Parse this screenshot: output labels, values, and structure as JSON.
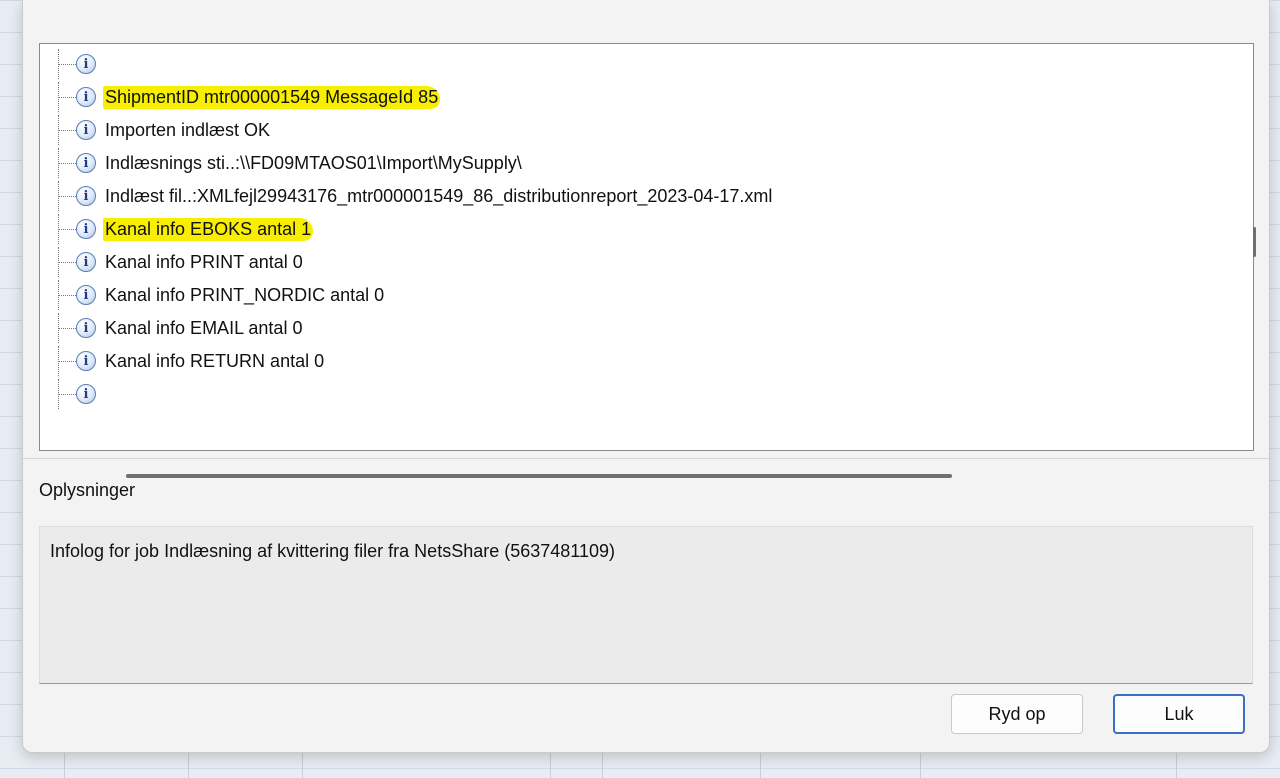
{
  "log_tree": {
    "items": [
      {
        "text": "",
        "highlighted": false
      },
      {
        "text": "ShipmentID mtr000001549 MessageId 85",
        "highlighted": true
      },
      {
        "text": "Importen indlæst OK",
        "highlighted": false
      },
      {
        "text": "Indlæsnings sti..:\\\\FD09MTAOS01\\Import\\MySupply\\",
        "highlighted": false
      },
      {
        "text": "Indlæst fil..:XMLfejl29943176_mtr000001549_86_distributionreport_2023-04-17.xml",
        "highlighted": false
      },
      {
        "text": "Kanal info EBOKS antal 1",
        "highlighted": true
      },
      {
        "text": "Kanal info PRINT antal 0",
        "highlighted": false
      },
      {
        "text": "Kanal info PRINT_NORDIC antal 0",
        "highlighted": false
      },
      {
        "text": "Kanal info EMAIL antal 0",
        "highlighted": false
      },
      {
        "text": "Kanal info RETURN antal 0",
        "highlighted": false
      },
      {
        "text": "",
        "highlighted": false
      }
    ],
    "icon": "info-icon"
  },
  "details": {
    "label": "Oplysninger",
    "text": "Infolog for job Indlæsning af kvittering filer fra NetsShare (5637481109)"
  },
  "buttons": {
    "clean_label": "Ryd op",
    "close_label": "Luk"
  },
  "colors": {
    "highlight": "#f8ef00",
    "primary_border": "#3a6fc4",
    "icon_blue": "#1d3f8a"
  }
}
